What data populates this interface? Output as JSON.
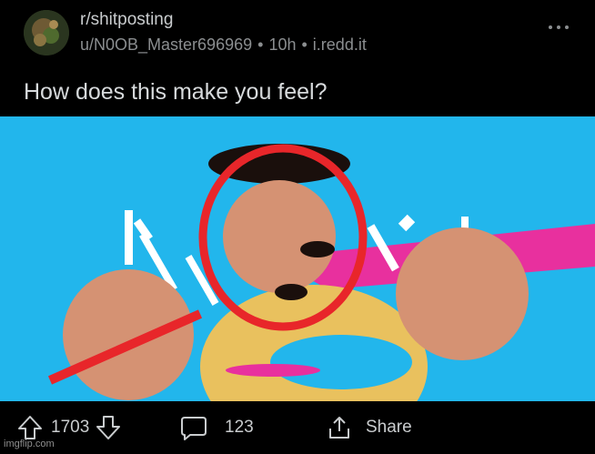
{
  "post": {
    "subreddit": "r/shitposting",
    "author": "u/N0OB_Master696969",
    "age": "10h",
    "domain": "i.redd.it",
    "title": "How does this make you feel?"
  },
  "actions": {
    "upvotes": "1703",
    "comments": "123",
    "share_label": "Share"
  },
  "watermark": "imgflip.com",
  "colors": {
    "background": "#000000",
    "image_bg": "#22b6ec",
    "skin": "#d59273",
    "red_circle": "#e8262a",
    "magenta": "#e8309e",
    "donut": "#e9c15e"
  },
  "icons": [
    "upvote-icon",
    "downvote-icon",
    "comment-icon",
    "share-icon",
    "more-options-icon"
  ]
}
